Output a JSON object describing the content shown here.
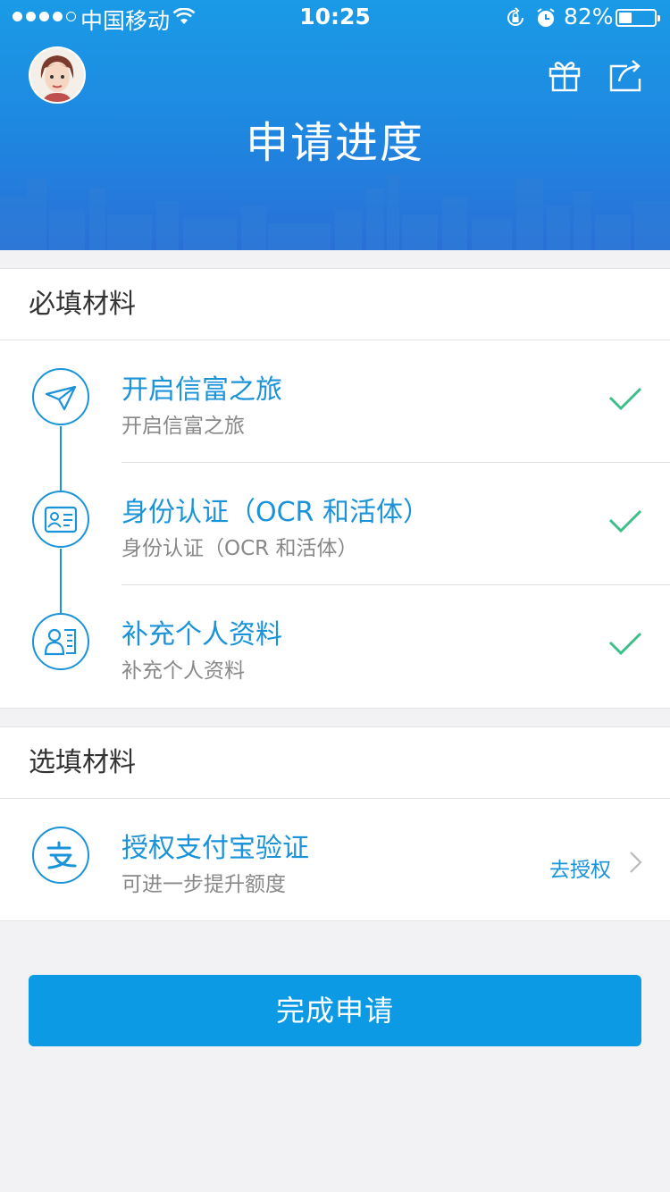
{
  "status_bar": {
    "carrier": "中国移动",
    "time": "10:25",
    "battery_percent_text": "82%",
    "battery_level": 0.82
  },
  "header": {
    "title": "申请进度",
    "icons": [
      "avatar",
      "gift-icon",
      "share-icon"
    ]
  },
  "required_section": {
    "title": "必填材料",
    "items": [
      {
        "title": "开启信富之旅",
        "subtitle": "开启信富之旅",
        "icon": "paper-plane-icon",
        "status": "done"
      },
      {
        "title": "身份认证（OCR 和活体）",
        "subtitle": "身份认证（OCR 和活体）",
        "icon": "id-card-icon",
        "status": "done"
      },
      {
        "title": "补充个人资料",
        "subtitle": "补充个人资料",
        "icon": "profile-icon",
        "status": "done"
      }
    ]
  },
  "optional_section": {
    "title": "选填材料",
    "items": [
      {
        "title": "授权支付宝验证",
        "subtitle": "可进一步提升额度",
        "icon": "alipay-icon",
        "action": "去授权"
      }
    ]
  },
  "submit": {
    "label": "完成申请"
  },
  "colors": {
    "accent": "#1a93d8",
    "button": "#0b9ae3",
    "check": "#3dbf8a",
    "header_top": "#1a9be6",
    "header_bottom": "#2a6fd6"
  }
}
